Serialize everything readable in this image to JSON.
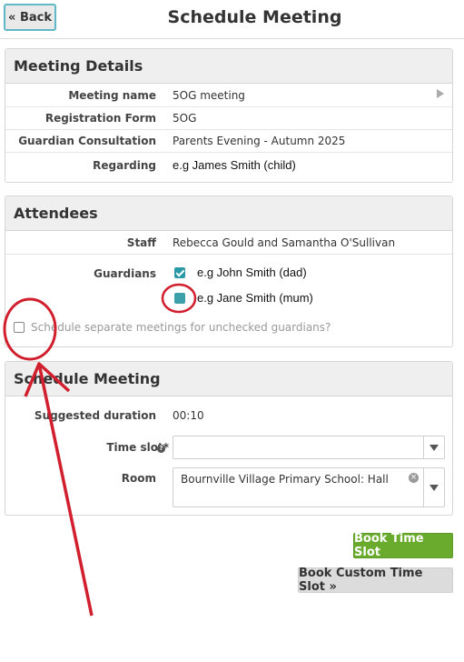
{
  "header": {
    "back_label": "« Back",
    "title": "Schedule Meeting"
  },
  "meeting_details": {
    "heading": "Meeting Details",
    "rows": [
      {
        "label": "Meeting name",
        "value": "5OG meeting"
      },
      {
        "label": "Registration Form",
        "value": "5OG"
      },
      {
        "label": "Guardian Consultation",
        "value": "Parents Evening - Autumn 2025"
      },
      {
        "label": "Regarding",
        "value": "e.g James Smith (child)"
      }
    ]
  },
  "attendees": {
    "heading": "Attendees",
    "staff_label": "Staff",
    "staff_value": "Rebecca Gould and Samantha O'Sullivan",
    "guardians_label": "Guardians",
    "guardians": [
      {
        "name": "e.g John Smith (dad)",
        "checked": true
      },
      {
        "name": "e.g Jane Smith (mum)",
        "checked": false
      }
    ],
    "separate_meetings_label": "Schedule separate meetings for unchecked guardians?"
  },
  "schedule": {
    "heading": "Schedule Meeting",
    "duration_label": "Suggested duration",
    "duration_value": "00:10",
    "timeslot_label": "Time slot*",
    "timeslot_value": "",
    "room_label": "Room",
    "room_value": "Bournville Village Primary School: Hall"
  },
  "actions": {
    "book_label": "Book Time Slot",
    "custom_label": "Book Custom Time Slot »"
  },
  "colors": {
    "accent": "#2a9aa6",
    "green": "#6aab2e",
    "annotation_red": "#d11f2e"
  }
}
